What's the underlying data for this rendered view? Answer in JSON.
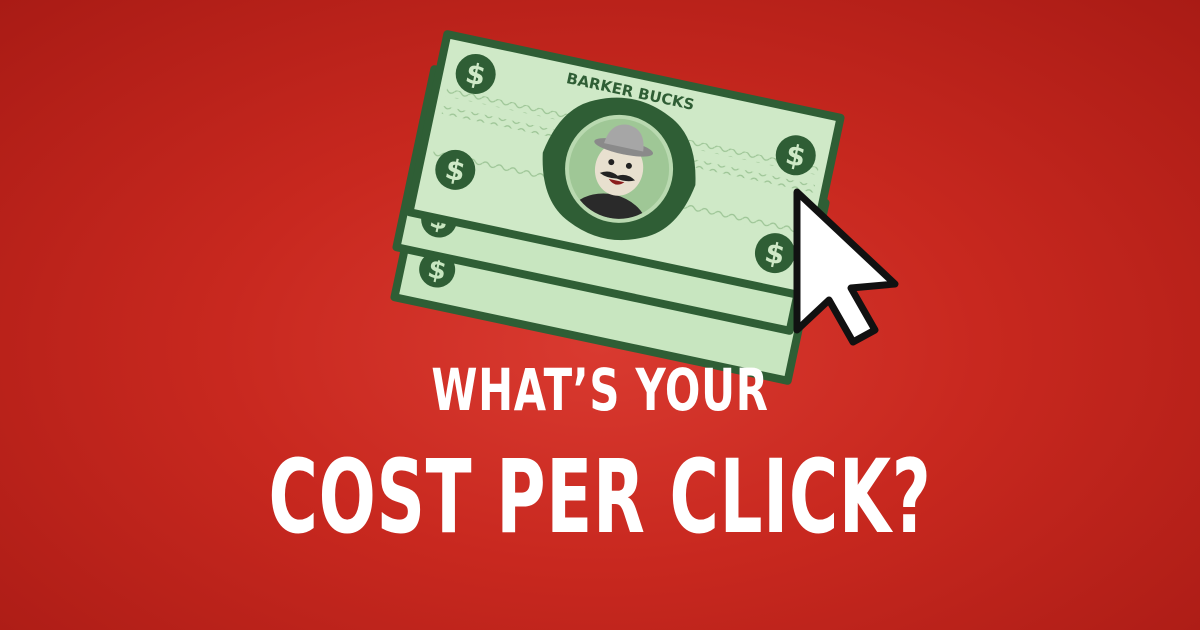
{
  "graphic": {
    "bill_brand": "BARKER BUCKS",
    "dollar_symbol": "$",
    "icons": [
      "dollar-bill-stack",
      "mascot-portrait",
      "mouse-pointer-cursor"
    ],
    "colors": {
      "background": "#c8281f",
      "bill_green": "#c8e6c0",
      "bill_dark": "#2f5e35",
      "text": "#ffffff"
    }
  },
  "headline": {
    "line1": "WHAT’S YOUR",
    "line2": "COST PER CLICK?"
  }
}
